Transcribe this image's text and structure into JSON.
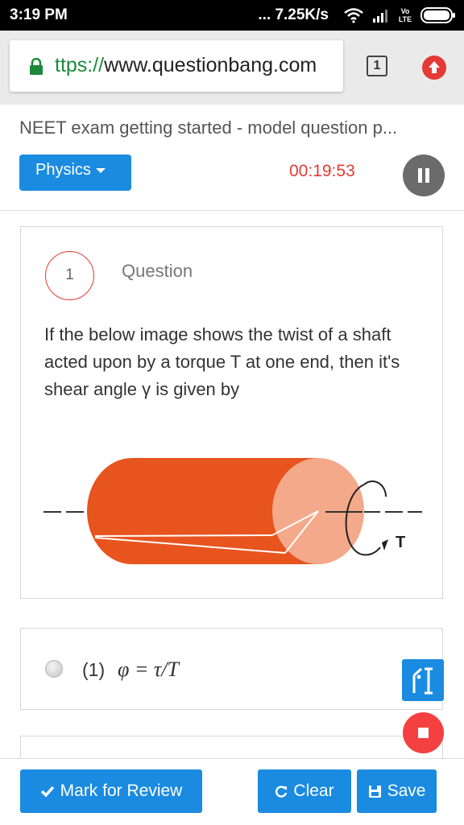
{
  "status_bar": {
    "time": "3:19 PM",
    "network_speed": "... 7.25K/s",
    "network_type": "Vo LTE"
  },
  "browser": {
    "url_scheme": "ttps://",
    "url_host": "www.questionbang.com",
    "tab_count": "1"
  },
  "header": {
    "title": "NEET exam getting started - model question p...",
    "subject_label": "Physics",
    "timer": "00:19:53"
  },
  "question": {
    "number": "1",
    "label": "Question",
    "text": "If the below image shows the twist of a shaft acted upon by a torque T at one end, then it's shear angle γ is given by",
    "image_label": "T"
  },
  "options": [
    {
      "number": "(1)",
      "formula": "φ = τ/T"
    }
  ],
  "footer": {
    "mark_review_label": "Mark for Review",
    "clear_label": "Clear",
    "save_label": "Save"
  },
  "colors": {
    "accent": "#1a8be0",
    "timer": "#e53935",
    "shaft": "#e8541e",
    "shaft_end": "#f4a98a"
  },
  "icons": [
    "lock-icon",
    "wifi-icon",
    "signal-icon",
    "battery-icon",
    "upload-icon",
    "pause-icon",
    "check-icon",
    "refresh-icon",
    "save-icon",
    "stop-icon",
    "review-person-icon"
  ]
}
